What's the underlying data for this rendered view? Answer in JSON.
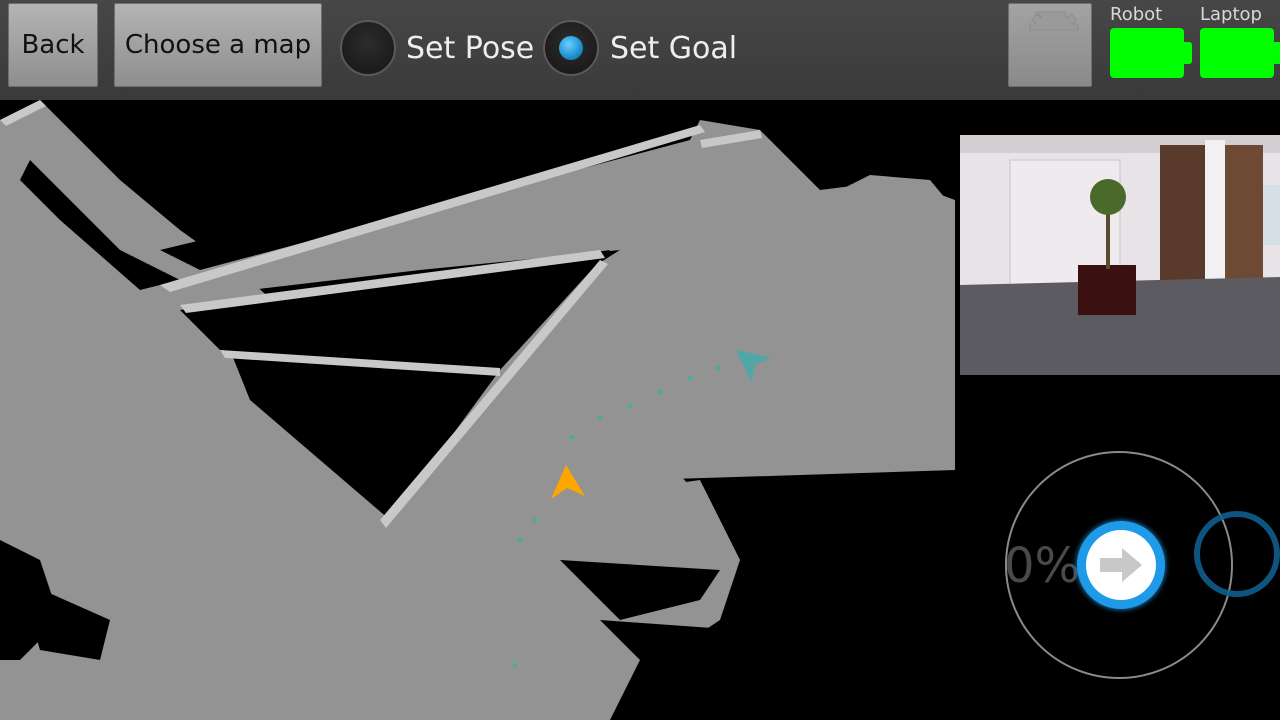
{
  "toolbar": {
    "back_label": "Back",
    "choose_map_label": "Choose a map",
    "set_pose_label": "Set Pose",
    "set_goal_label": "Set Goal",
    "selected_mode": "Set Goal",
    "settings_icon": "settings-icon"
  },
  "battery": {
    "robot_label": "Robot",
    "laptop_label": "Laptop",
    "color": "#00ff00"
  },
  "map": {
    "robot_marker_color": "#ffa500",
    "goal_marker_color": "#4ea8a8",
    "occupied_color": "#000000",
    "free_color": "#909090"
  },
  "joystick": {
    "speed_text": "0%",
    "accent_color": "#1e9ae8",
    "knob_icon": "arrow-right-icon"
  }
}
